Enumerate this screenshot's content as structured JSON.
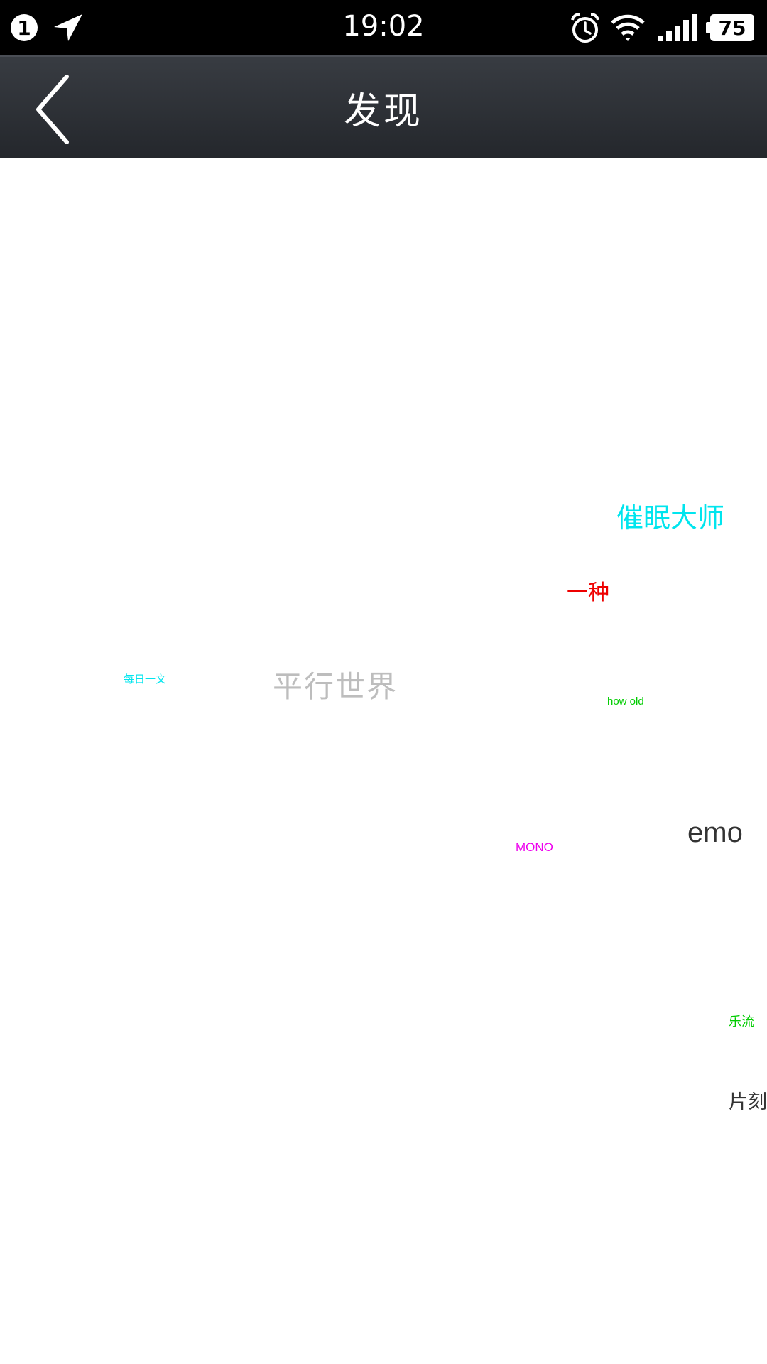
{
  "status_bar": {
    "notification_count": "1",
    "time": "19:02",
    "battery": "75",
    "icons": [
      "location-arrow-icon",
      "alarm-icon",
      "wifi-icon",
      "signal-icon",
      "battery-icon"
    ]
  },
  "header": {
    "title": "发现",
    "back_icon": "chevron-left-icon"
  },
  "tags": [
    {
      "label": "催眠大师",
      "color": "#00e5ee"
    },
    {
      "label": "一种",
      "color": "#ee0000"
    },
    {
      "label": "每日一文",
      "color": "#00e5ee"
    },
    {
      "label": "平行世界",
      "color": "#bdbdbd"
    },
    {
      "label": "how old",
      "color": "#00cc00"
    },
    {
      "label": "MONO",
      "color": "#ee00ee"
    },
    {
      "label": "emo",
      "color": "#333333"
    },
    {
      "label": "乐流",
      "color": "#00cc00"
    },
    {
      "label": "片刻",
      "color": "#333333"
    }
  ]
}
